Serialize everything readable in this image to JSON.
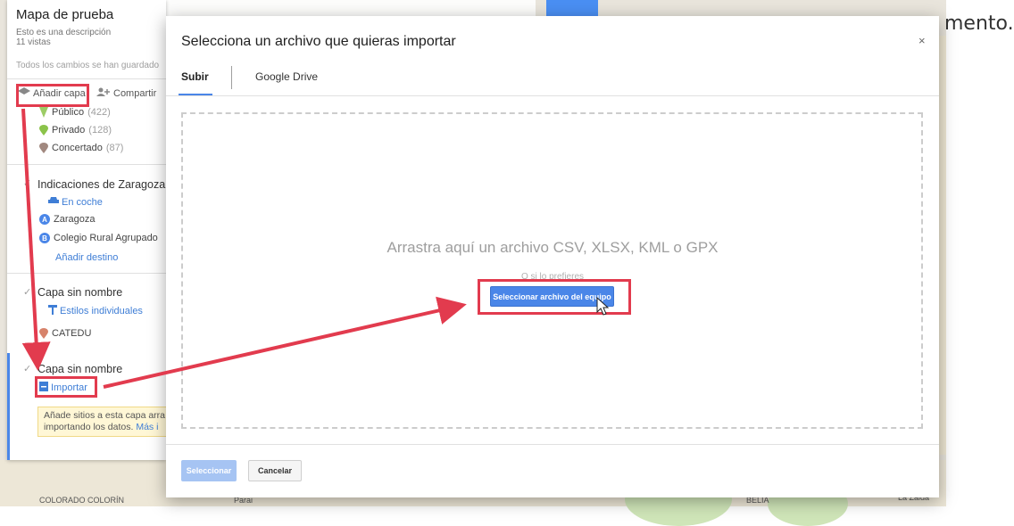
{
  "instruction_text": "mento.",
  "map_panel": {
    "title": "Mapa de prueba",
    "description": "Esto es una descripción",
    "views": "11 vistas",
    "saved_status": "Todos los cambios se han guardado",
    "add_layer_label": "Añadir capa",
    "share_label": "Compartir",
    "layer1_items": [
      {
        "label": "Público",
        "count": "(422)",
        "pin_color": "#9ccc65"
      },
      {
        "label": "Privado",
        "count": "(128)",
        "pin_color": "#8bc34a"
      },
      {
        "label": "Concertado",
        "count": "(87)",
        "pin_color": "#a1887f"
      }
    ],
    "directions_layer": {
      "title": "Indicaciones de Zaragoza a",
      "mode": "En coche",
      "point_a": {
        "badge": "A",
        "label": "Zaragoza"
      },
      "point_b": {
        "badge": "B",
        "label": "Colegio Rural Agrupado"
      },
      "add_destination": "Añadir destino"
    },
    "layer3": {
      "title": "Capa sin nombre",
      "style_link": "Estilos individuales",
      "item": "CATEDU",
      "pin_color": "#d7836b"
    },
    "layer4": {
      "title": "Capa sin nombre",
      "import_link": "Importar",
      "hint": "Añade sitios a esta capa arra importando los datos.",
      "hint_more": "Más i"
    }
  },
  "dialog": {
    "title": "Selecciona un archivo que quieras importar",
    "close_symbol": "×",
    "tabs": [
      {
        "label": "Subir"
      },
      {
        "label": "Google Drive"
      }
    ],
    "drop_text": "Arrastra aquí un archivo CSV, XLSX, KML o GPX",
    "or_text": "O si lo prefieres",
    "select_file_button": "Seleccionar archivo del equipo",
    "primary_button": "Seleccionar",
    "cancel_button": "Cancelar"
  },
  "map_labels": {
    "colorado": "COLORADO COLORÍN",
    "paraiso": "Parai",
    "belia": "BELIA",
    "la_zaida": "La Zaida"
  },
  "colors": {
    "highlight": "#e23b4e",
    "accent": "#4a86e8"
  }
}
